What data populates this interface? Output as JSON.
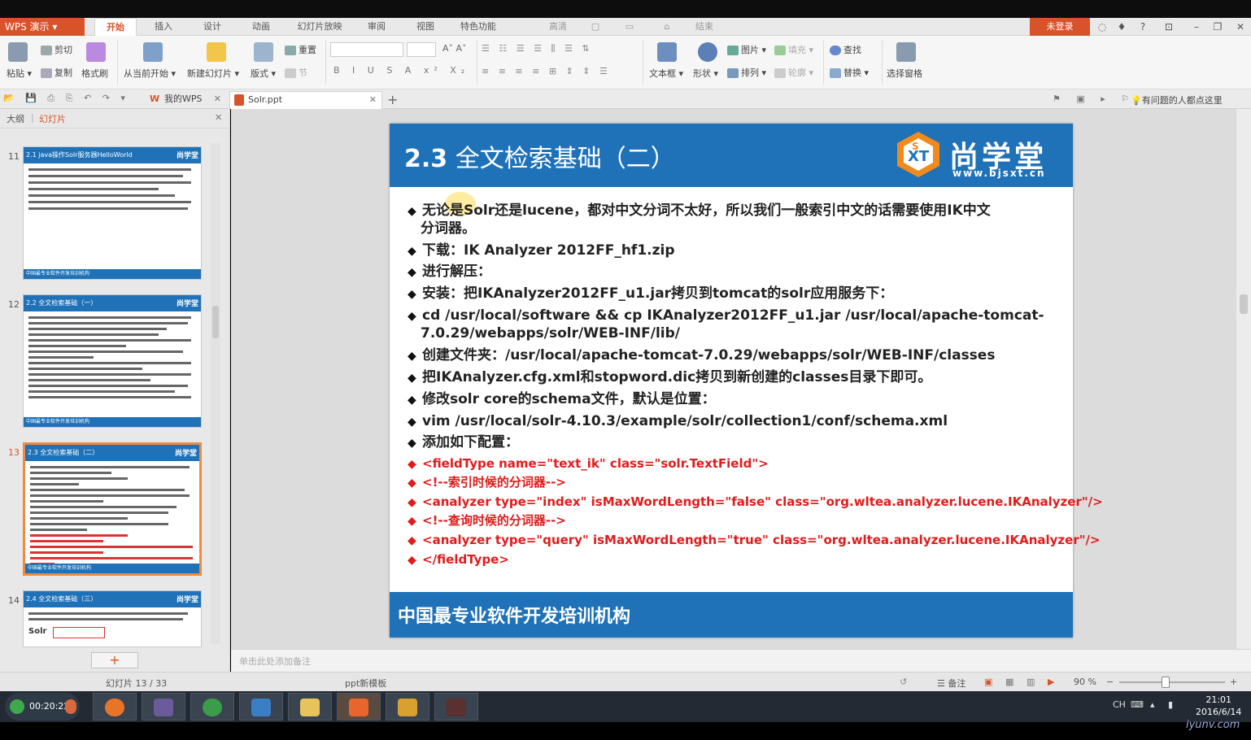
{
  "app": {
    "name": "WPS 演示"
  },
  "menu": {
    "tabs": [
      "开始",
      "插入",
      "设计",
      "动画",
      "幻灯片放映",
      "审阅",
      "视图",
      "特色功能"
    ],
    "extra": [
      "高清",
      "结束"
    ],
    "login": "未登录"
  },
  "ribbon": {
    "paste": "粘贴",
    "cut": "剪切",
    "copy": "复制",
    "format_painter": "格式刷",
    "from_current": "从当前开始",
    "new_slide": "新建幻灯片",
    "layout": "版式",
    "reset": "重置",
    "section": "节",
    "textbox": "文本框",
    "shape": "形状",
    "picture": "图片",
    "fill": "填充",
    "arrange": "排列",
    "outline": "轮廓",
    "find": "查找",
    "replace": "替换",
    "select_pane": "选择窗格"
  },
  "doctabs": {
    "mywps": "我的WPS",
    "current": "Solr.ppt",
    "help": "有问题的人都点这里"
  },
  "left_panel": {
    "tab_outline": "大纲",
    "tab_slides": "幻灯片",
    "thumbs": [
      {
        "num": "11",
        "title": "2.1 java操作Solr服务器HelloWorld"
      },
      {
        "num": "12",
        "title": "2.2 全文检索基础（一）"
      },
      {
        "num": "13",
        "title": "2.3 全文检索基础（二）"
      },
      {
        "num": "14",
        "title": "2.4 全文检索基础（三）"
      }
    ],
    "thumb_logo": "尚学堂",
    "thumb_footer": "中国最专业软件开发培训机构",
    "thumb14_badge": "Solr"
  },
  "slide": {
    "title_num": "2.3",
    "title_text": "全文检索基础（二）",
    "logo_cn": "尚学堂",
    "logo_url": "www.bjsxt.cn",
    "footer": "中国最专业软件开发培训机构",
    "bullets": [
      "无论是Solr还是lucene，都对中文分词不太好，所以我们一般索引中文的话需要使用IK中文",
      "下载：IK Analyzer 2012FF_hf1.zip",
      "进行解压：",
      "安装：把IKAnalyzer2012FF_u1.jar拷贝到tomcat的solr应用服务下：",
      "cd /usr/local/software && cp IKAnalyzer2012FF_u1.jar /usr/local/apache-tomcat-",
      "创建文件夹：/usr/local/apache-tomcat-7.0.29/webapps/solr/WEB-INF/classes",
      "把IKAnalyzer.cfg.xml和stopword.dic拷贝到新创建的classes目录下即可。",
      "修改solr core的schema文件，默认是位置：",
      "vim /usr/local/solr-4.10.3/example/solr/collection1/conf/schema.xml",
      "添加如下配置："
    ],
    "continuations": [
      "分词器。",
      "7.0.29/webapps/solr/WEB-INF/lib/"
    ],
    "code": [
      "<fieldType name=\"text_ik\" class=\"solr.TextField\">",
      "<!--索引时候的分词器-->",
      "<analyzer type=\"index\" isMaxWordLength=\"false\" class=\"org.wltea.analyzer.lucene.IKAnalyzer\"/>",
      "<!--查询时候的分词器-->",
      "<analyzer type=\"query\" isMaxWordLength=\"true\" class=\"org.wltea.analyzer.lucene.IKAnalyzer\"/>",
      "</fieldType>"
    ]
  },
  "notes_placeholder": "单击此处添加备注",
  "status": {
    "slide_pos": "幻灯片 13 / 33",
    "template": "ppt新模板",
    "notes": "备注",
    "zoom": "90 %"
  },
  "taskbar": {
    "timer": "00:20:22",
    "lang": "CH",
    "time": "21:01",
    "date": "2016/6/14"
  },
  "watermark": "iyunv.com",
  "colors": {
    "accent": "#d9532a",
    "slide_blue": "#1f72b8",
    "code_red": "#e01b1b",
    "thumb_selected": "#f08a3c"
  }
}
